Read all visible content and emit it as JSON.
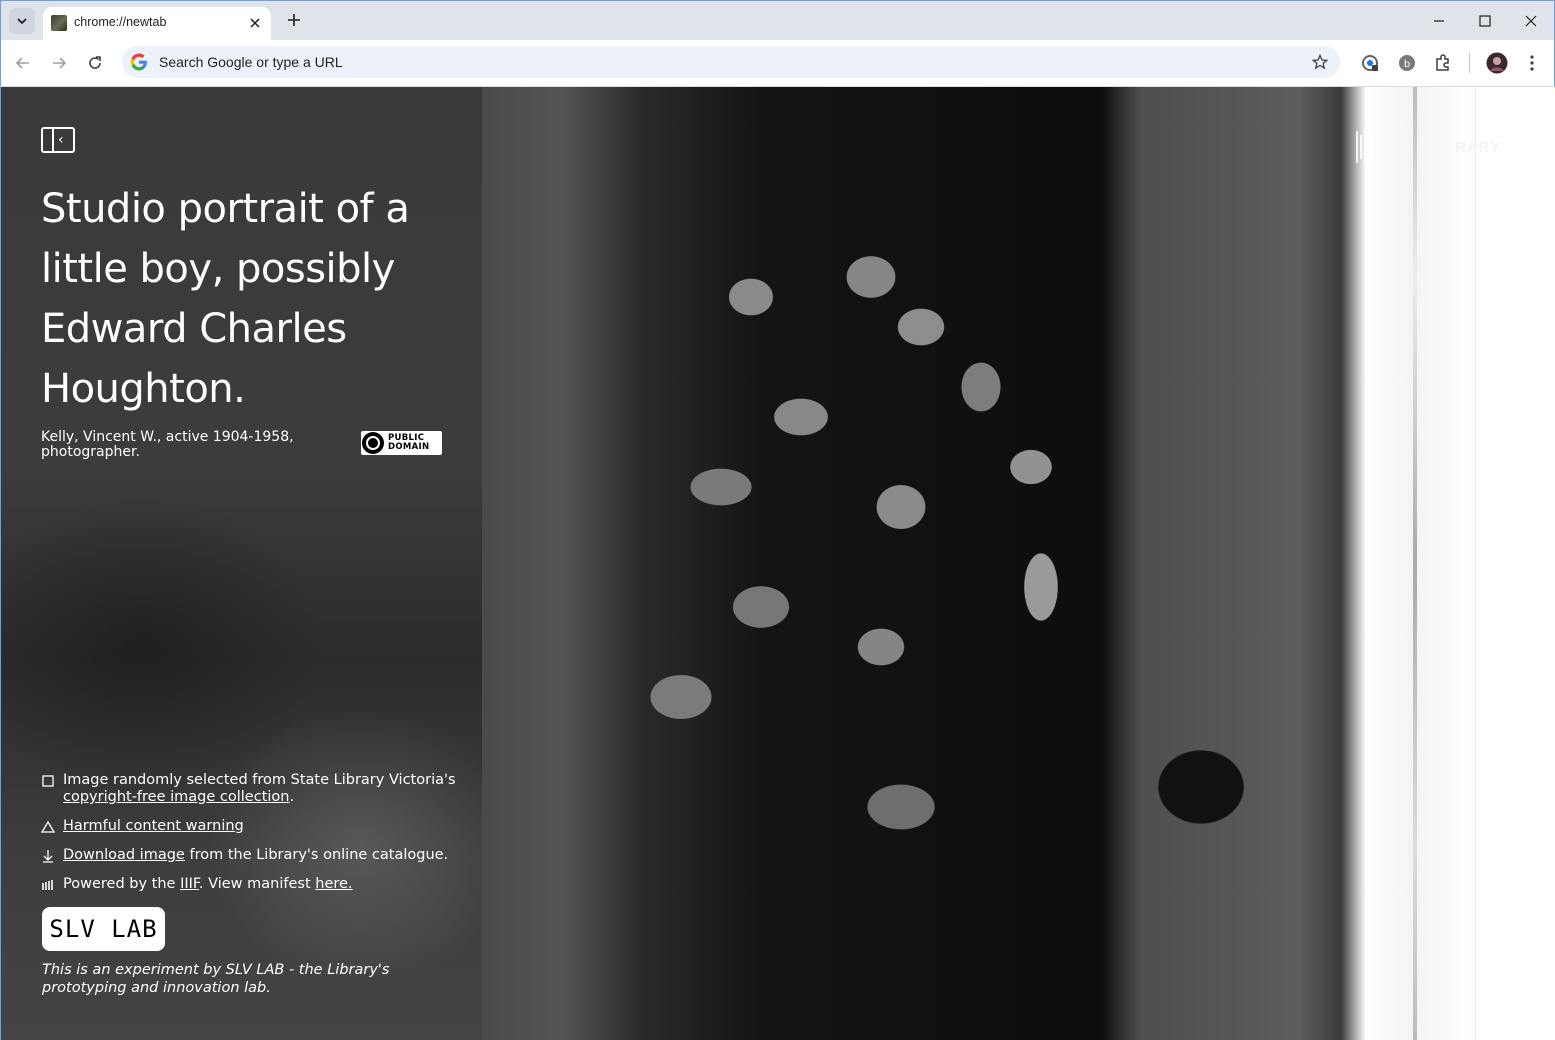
{
  "browser": {
    "tab_title": "chrome://newtab",
    "omnibox_placeholder": "Search Google or type a URL",
    "profile_initial": "b"
  },
  "artwork": {
    "title": "Studio portrait of a little boy, possibly Edward Charles Houghton.",
    "creator": "Kelly, Vincent W., active 1904-1958, photographer.",
    "license_line1": "PUBLIC",
    "license_line2": "DOMAIN",
    "library_label": "RARY"
  },
  "info": {
    "random_prefix": "Image randomly selected from State Library Victoria's",
    "random_link": "copyright-free image collection",
    "random_suffix": ".",
    "harmful_link": "Harmful content warning",
    "download_link": "Download image",
    "download_suffix": " from the Library's online catalogue.",
    "powered_prefix": "Powered by the ",
    "powered_link": "IIIF",
    "powered_middle": ". View manifest ",
    "powered_link2": "here.",
    "slv_lab": "SLV LAB",
    "experiment": "This is an experiment by SLV LAB - the Library's prototyping and innovation lab."
  },
  "icons": {
    "tab_search": "chevron-down-icon",
    "close": "close-icon",
    "new_tab": "plus-icon",
    "minimize": "minimize-icon",
    "maximize": "maximize-icon",
    "back": "arrow-left-icon",
    "forward": "arrow-right-icon",
    "reload": "reload-icon",
    "bookmark": "star-icon",
    "extensions": "puzzle-icon",
    "menu": "kebab-menu-icon"
  }
}
